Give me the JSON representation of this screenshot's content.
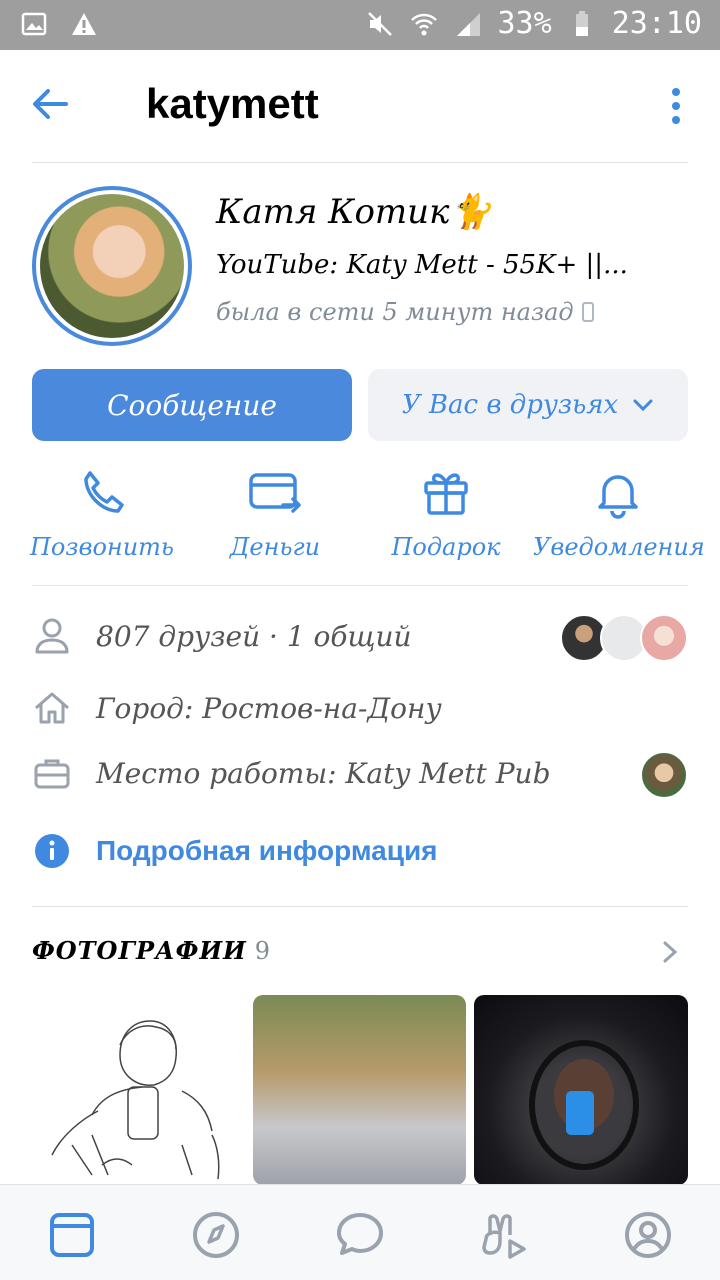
{
  "statusbar": {
    "battery": "33%",
    "time": "23:10"
  },
  "header": {
    "title": "katymett"
  },
  "profile": {
    "name": "Катя Котик🐈",
    "status": "YouTube: Katy Mett - 55K+ ||...",
    "online": "была в сети 5 минут назад"
  },
  "buttons": {
    "message": "Сообщение",
    "friends": "У Вас в друзьях"
  },
  "actions": [
    {
      "label": "Позвонить",
      "icon": "phone-icon"
    },
    {
      "label": "Деньги",
      "icon": "money-card-icon"
    },
    {
      "label": "Подарок",
      "icon": "gift-icon"
    },
    {
      "label": "Уведомления",
      "icon": "bell-icon"
    }
  ],
  "info": {
    "friends": "807 друзей · 1 общий",
    "city": "Город: Ростов-на-Дону",
    "work": "Место работы: Katy Mett Pub",
    "more": "Подробная информация"
  },
  "photos": {
    "title": "ФОТОГРАФИИ",
    "count": "9"
  },
  "colors": {
    "accent": "#4a89dc",
    "link": "#3f8ae0",
    "muted": "#818c99"
  }
}
